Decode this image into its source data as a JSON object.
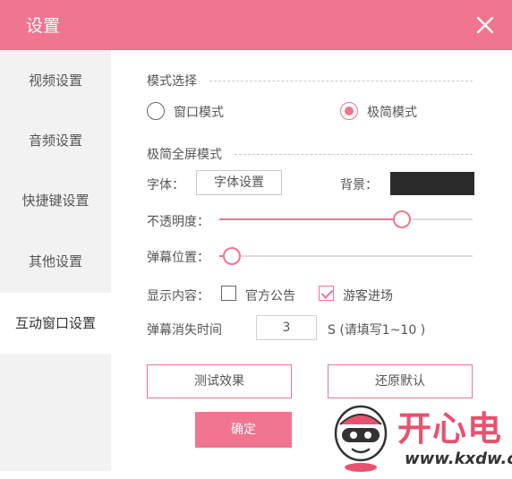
{
  "window": {
    "title": "设置"
  },
  "sidebar": {
    "items": [
      {
        "label": "视频设置"
      },
      {
        "label": "音频设置"
      },
      {
        "label": "快捷键设置"
      },
      {
        "label": "其他设置"
      },
      {
        "label": "互动窗口设置",
        "active": true
      }
    ]
  },
  "mode": {
    "section_label": "模式选择",
    "options": [
      {
        "label": "窗口模式",
        "selected": false
      },
      {
        "label": "极简模式",
        "selected": true
      }
    ]
  },
  "fullscreen": {
    "section_label": "极简全屏模式",
    "font_label": "字体：",
    "font_button": "字体设置",
    "bg_label": "背景：",
    "bg_color": "#2b2b2b",
    "opacity_label": "不透明度：",
    "opacity_value": 0.72,
    "position_label": "弹幕位置：",
    "position_value": 0.05,
    "display_label": "显示内容：",
    "display_options": [
      {
        "label": "官方公告",
        "checked": false
      },
      {
        "label": "游客进场",
        "checked": true
      }
    ],
    "vanish_label": "弹幕消失时间",
    "vanish_value": "3",
    "vanish_hint": "S (请填写1~10 )"
  },
  "actions": {
    "test_label": "测试效果",
    "restore_label": "还原默认",
    "confirm_label": "确定"
  },
  "watermark": {
    "brand": "开心电",
    "url": "www.kxdw.c"
  },
  "colors": {
    "accent": "#f0758f",
    "sidebar_bg": "#f2f2f2"
  }
}
